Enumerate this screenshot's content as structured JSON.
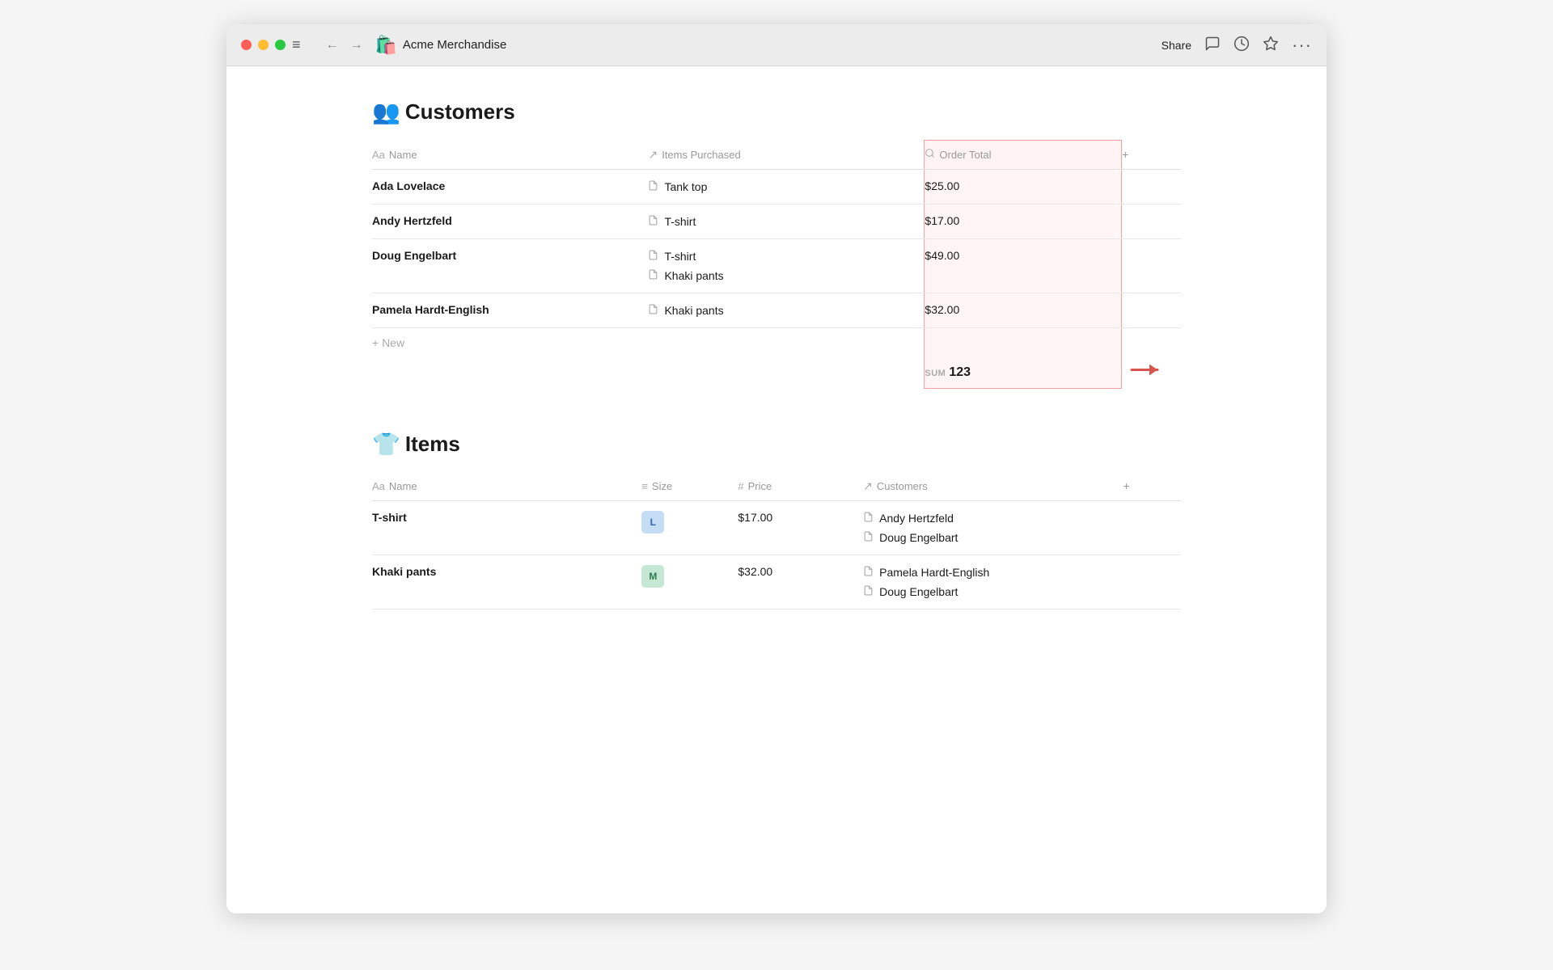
{
  "titlebar": {
    "app_title": "Acme Merchandise",
    "app_icon": "🛍️",
    "share_label": "Share",
    "nav": {
      "back_icon": "←",
      "forward_icon": "→",
      "hamburger_icon": "≡"
    },
    "actions": {
      "comment_icon": "💬",
      "history_icon": "🕐",
      "star_icon": "☆",
      "more_icon": "···"
    }
  },
  "customers_section": {
    "icon": "👥",
    "title": "Customers",
    "columns": {
      "name": {
        "icon": "Aa",
        "label": "Name"
      },
      "items_purchased": {
        "icon": "↗",
        "label": "Items Purchased"
      },
      "order_total": {
        "icon": "🔍",
        "label": "Order Total"
      },
      "add": "+"
    },
    "rows": [
      {
        "name": "Ada Lovelace",
        "items": [
          "Tank top"
        ],
        "order_total": "$25.00"
      },
      {
        "name": "Andy Hertzfeld",
        "items": [
          "T-shirt"
        ],
        "order_total": "$17.00"
      },
      {
        "name": "Doug Engelbart",
        "items": [
          "T-shirt",
          "Khaki pants"
        ],
        "order_total": "$49.00"
      },
      {
        "name": "Pamela Hardt-English",
        "items": [
          "Khaki pants"
        ],
        "order_total": "$32.00"
      }
    ],
    "new_label": "+ New",
    "sum_label": "SUM",
    "sum_value": "123"
  },
  "items_section": {
    "icon": "👕",
    "title": "Items",
    "columns": {
      "name": {
        "icon": "Aa",
        "label": "Name"
      },
      "size": {
        "icon": "≡",
        "label": "Size"
      },
      "price": {
        "icon": "#",
        "label": "Price"
      },
      "customers": {
        "icon": "↗",
        "label": "Customers"
      },
      "add": "+"
    },
    "rows": [
      {
        "name": "T-shirt",
        "size": "L",
        "size_class": "size-L",
        "price": "$17.00",
        "customers": [
          "Andy Hertzfeld",
          "Doug Engelbart"
        ]
      },
      {
        "name": "Khaki pants",
        "size": "M",
        "size_class": "size-M",
        "price": "$32.00",
        "customers": [
          "Pamela Hardt-English",
          "Doug Engelbart"
        ]
      }
    ]
  }
}
